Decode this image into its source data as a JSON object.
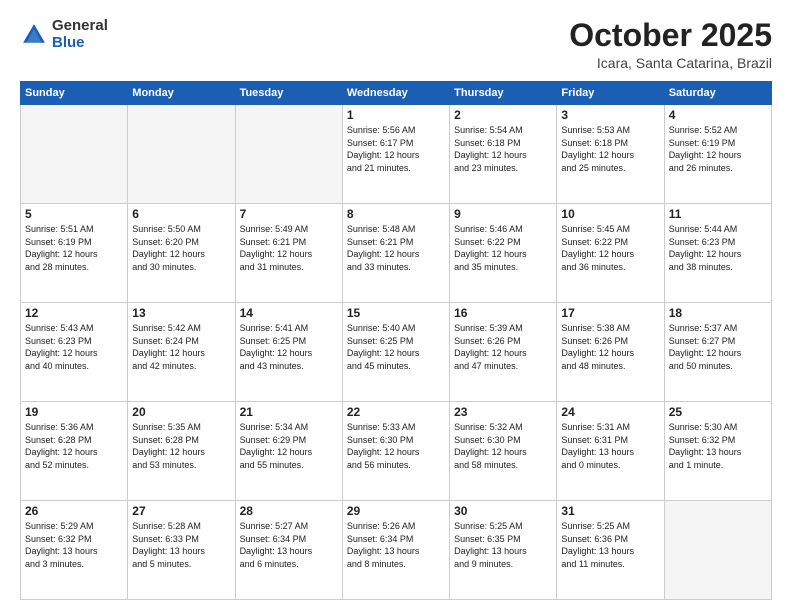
{
  "logo": {
    "general": "General",
    "blue": "Blue"
  },
  "title": "October 2025",
  "subtitle": "Icara, Santa Catarina, Brazil",
  "weekdays": [
    "Sunday",
    "Monday",
    "Tuesday",
    "Wednesday",
    "Thursday",
    "Friday",
    "Saturday"
  ],
  "weeks": [
    [
      {
        "day": "",
        "info": ""
      },
      {
        "day": "",
        "info": ""
      },
      {
        "day": "",
        "info": ""
      },
      {
        "day": "1",
        "info": "Sunrise: 5:56 AM\nSunset: 6:17 PM\nDaylight: 12 hours\nand 21 minutes."
      },
      {
        "day": "2",
        "info": "Sunrise: 5:54 AM\nSunset: 6:18 PM\nDaylight: 12 hours\nand 23 minutes."
      },
      {
        "day": "3",
        "info": "Sunrise: 5:53 AM\nSunset: 6:18 PM\nDaylight: 12 hours\nand 25 minutes."
      },
      {
        "day": "4",
        "info": "Sunrise: 5:52 AM\nSunset: 6:19 PM\nDaylight: 12 hours\nand 26 minutes."
      }
    ],
    [
      {
        "day": "5",
        "info": "Sunrise: 5:51 AM\nSunset: 6:19 PM\nDaylight: 12 hours\nand 28 minutes."
      },
      {
        "day": "6",
        "info": "Sunrise: 5:50 AM\nSunset: 6:20 PM\nDaylight: 12 hours\nand 30 minutes."
      },
      {
        "day": "7",
        "info": "Sunrise: 5:49 AM\nSunset: 6:21 PM\nDaylight: 12 hours\nand 31 minutes."
      },
      {
        "day": "8",
        "info": "Sunrise: 5:48 AM\nSunset: 6:21 PM\nDaylight: 12 hours\nand 33 minutes."
      },
      {
        "day": "9",
        "info": "Sunrise: 5:46 AM\nSunset: 6:22 PM\nDaylight: 12 hours\nand 35 minutes."
      },
      {
        "day": "10",
        "info": "Sunrise: 5:45 AM\nSunset: 6:22 PM\nDaylight: 12 hours\nand 36 minutes."
      },
      {
        "day": "11",
        "info": "Sunrise: 5:44 AM\nSunset: 6:23 PM\nDaylight: 12 hours\nand 38 minutes."
      }
    ],
    [
      {
        "day": "12",
        "info": "Sunrise: 5:43 AM\nSunset: 6:23 PM\nDaylight: 12 hours\nand 40 minutes."
      },
      {
        "day": "13",
        "info": "Sunrise: 5:42 AM\nSunset: 6:24 PM\nDaylight: 12 hours\nand 42 minutes."
      },
      {
        "day": "14",
        "info": "Sunrise: 5:41 AM\nSunset: 6:25 PM\nDaylight: 12 hours\nand 43 minutes."
      },
      {
        "day": "15",
        "info": "Sunrise: 5:40 AM\nSunset: 6:25 PM\nDaylight: 12 hours\nand 45 minutes."
      },
      {
        "day": "16",
        "info": "Sunrise: 5:39 AM\nSunset: 6:26 PM\nDaylight: 12 hours\nand 47 minutes."
      },
      {
        "day": "17",
        "info": "Sunrise: 5:38 AM\nSunset: 6:26 PM\nDaylight: 12 hours\nand 48 minutes."
      },
      {
        "day": "18",
        "info": "Sunrise: 5:37 AM\nSunset: 6:27 PM\nDaylight: 12 hours\nand 50 minutes."
      }
    ],
    [
      {
        "day": "19",
        "info": "Sunrise: 5:36 AM\nSunset: 6:28 PM\nDaylight: 12 hours\nand 52 minutes."
      },
      {
        "day": "20",
        "info": "Sunrise: 5:35 AM\nSunset: 6:28 PM\nDaylight: 12 hours\nand 53 minutes."
      },
      {
        "day": "21",
        "info": "Sunrise: 5:34 AM\nSunset: 6:29 PM\nDaylight: 12 hours\nand 55 minutes."
      },
      {
        "day": "22",
        "info": "Sunrise: 5:33 AM\nSunset: 6:30 PM\nDaylight: 12 hours\nand 56 minutes."
      },
      {
        "day": "23",
        "info": "Sunrise: 5:32 AM\nSunset: 6:30 PM\nDaylight: 12 hours\nand 58 minutes."
      },
      {
        "day": "24",
        "info": "Sunrise: 5:31 AM\nSunset: 6:31 PM\nDaylight: 13 hours\nand 0 minutes."
      },
      {
        "day": "25",
        "info": "Sunrise: 5:30 AM\nSunset: 6:32 PM\nDaylight: 13 hours\nand 1 minute."
      }
    ],
    [
      {
        "day": "26",
        "info": "Sunrise: 5:29 AM\nSunset: 6:32 PM\nDaylight: 13 hours\nand 3 minutes."
      },
      {
        "day": "27",
        "info": "Sunrise: 5:28 AM\nSunset: 6:33 PM\nDaylight: 13 hours\nand 5 minutes."
      },
      {
        "day": "28",
        "info": "Sunrise: 5:27 AM\nSunset: 6:34 PM\nDaylight: 13 hours\nand 6 minutes."
      },
      {
        "day": "29",
        "info": "Sunrise: 5:26 AM\nSunset: 6:34 PM\nDaylight: 13 hours\nand 8 minutes."
      },
      {
        "day": "30",
        "info": "Sunrise: 5:25 AM\nSunset: 6:35 PM\nDaylight: 13 hours\nand 9 minutes."
      },
      {
        "day": "31",
        "info": "Sunrise: 5:25 AM\nSunset: 6:36 PM\nDaylight: 13 hours\nand 11 minutes."
      },
      {
        "day": "",
        "info": ""
      }
    ]
  ]
}
